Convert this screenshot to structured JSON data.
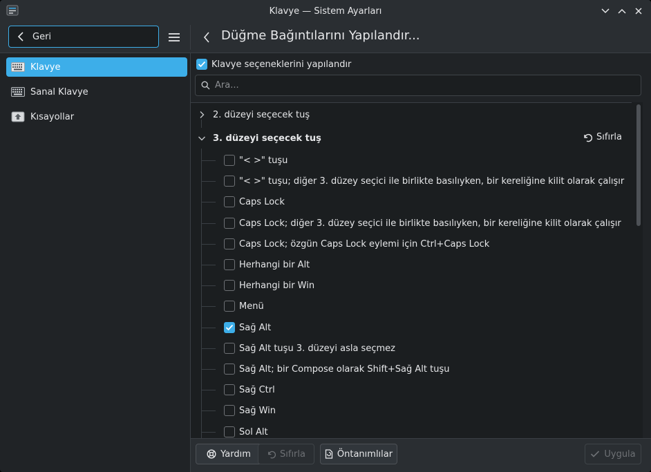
{
  "window": {
    "title": "Klavye — Sistem Ayarları"
  },
  "header": {
    "back_label": "Geri",
    "page_title": "Düğme Bağıntılarını Yapılandır..."
  },
  "sidebar": {
    "items": [
      {
        "label": "Klavye",
        "icon": "keyboard-icon",
        "active": true
      },
      {
        "label": "Sanal Klavye",
        "icon": "virtual-keyboard-icon",
        "active": false
      },
      {
        "label": "Kısayollar",
        "icon": "shortcuts-icon",
        "active": false
      }
    ]
  },
  "main": {
    "configure_label": "Klavye seçeneklerini yapılandır",
    "configure_checked": true,
    "search_placeholder": "Ara...",
    "groups": [
      {
        "label": "2. düzeyi seçecek tuş",
        "expanded": false
      },
      {
        "label": "3. düzeyi seçecek tuş",
        "expanded": true,
        "reset_label": "Sıfırla"
      }
    ],
    "options": [
      {
        "label": "\"< >\" tuşu",
        "checked": false
      },
      {
        "label": "\"< >\" tuşu; diğer 3. düzey seçici ile birlikte basılıyken, bir kereliğine kilit olarak çalışır",
        "checked": false
      },
      {
        "label": "Caps Lock",
        "checked": false
      },
      {
        "label": "Caps Lock; diğer 3. düzey seçici ile birlikte basılıyken, bir kereliğine kilit olarak çalışır",
        "checked": false
      },
      {
        "label": "Caps Lock; özgün Caps Lock eylemi için Ctrl+Caps Lock",
        "checked": false
      },
      {
        "label": "Herhangi bir Alt",
        "checked": false
      },
      {
        "label": "Herhangi bir Win",
        "checked": false
      },
      {
        "label": "Menü",
        "checked": false
      },
      {
        "label": "Sağ Alt",
        "checked": true
      },
      {
        "label": "Sağ Alt tuşu 3. düzeyi asla seçmez",
        "checked": false
      },
      {
        "label": "Sağ Alt; bir Compose olarak Shift+Sağ Alt tuşu",
        "checked": false
      },
      {
        "label": "Sağ Ctrl",
        "checked": false
      },
      {
        "label": "Sağ Win",
        "checked": false
      },
      {
        "label": "Sol Alt",
        "checked": false
      }
    ]
  },
  "bottombar": {
    "help_label": "Yardım",
    "reset_label": "Sıfırla",
    "defaults_label": "Öntanımlılar",
    "apply_label": "Uygula"
  },
  "colors": {
    "accent": "#3daee9",
    "window_bg": "#202326",
    "view_bg": "#1b1e20"
  }
}
